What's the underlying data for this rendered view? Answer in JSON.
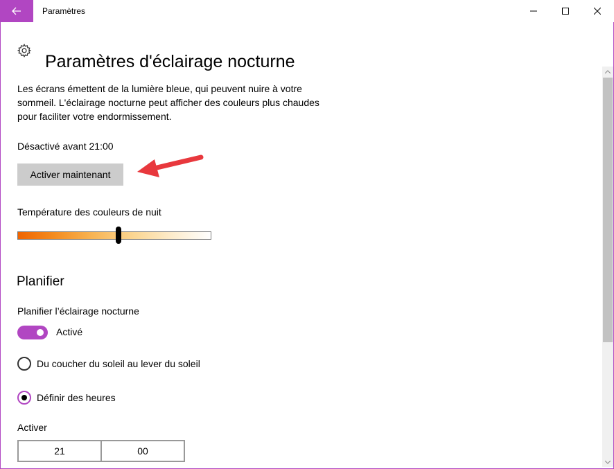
{
  "titlebar": {
    "title": "Paramètres",
    "back_icon": "arrow-left-icon",
    "accent_color": "#b146c2",
    "controls": [
      "minimize-icon",
      "maximize-icon",
      "close-icon"
    ]
  },
  "header": {
    "icon": "gear-icon",
    "title": "Paramètres d'éclairage nocturne"
  },
  "main": {
    "description": "Les écrans émettent de la lumière bleue, qui peuvent nuire à votre sommeil. L'éclairage nocturne peut afficher des couleurs plus chaudes pour faciliter votre endormissement.",
    "status": "Désactivé avant 21:00",
    "activate_button": "Activer maintenant",
    "annotation_arrow_color": "#e8383d",
    "temperature": {
      "label": "Température des couleurs de nuit",
      "level": 0.52
    }
  },
  "schedule": {
    "section_title": "Planifier",
    "label": "Planifier l’éclairage nocturne",
    "toggle_state": "Activé",
    "toggle_on": true,
    "options": [
      {
        "label": "Du coucher du soleil au lever du soleil",
        "selected": false
      },
      {
        "label": "Définir des heures",
        "selected": true
      }
    ],
    "turn_on": {
      "label": "Activer",
      "hour": "21",
      "minute": "00"
    }
  }
}
